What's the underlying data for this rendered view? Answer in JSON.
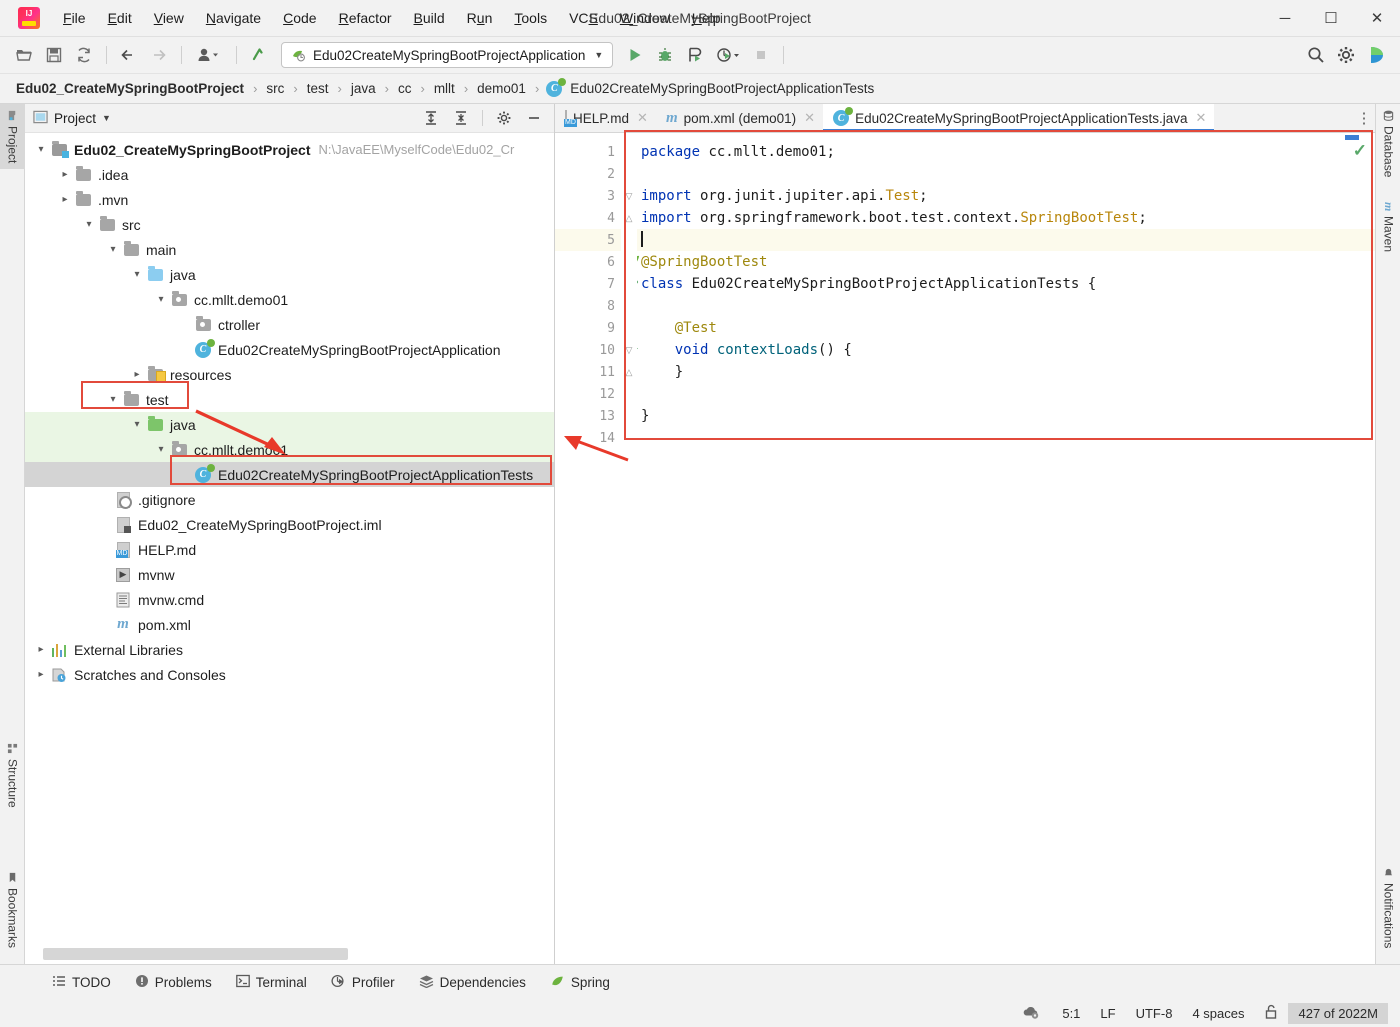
{
  "window": {
    "title": "Edu02_CreateMySpringBootProject",
    "minimize": "─",
    "maximize": "☐",
    "close": "✕"
  },
  "menubar": {
    "items": [
      "File",
      "Edit",
      "View",
      "Navigate",
      "Code",
      "Refactor",
      "Build",
      "Run",
      "Tools",
      "VCS",
      "Window",
      "Help"
    ]
  },
  "toolbar": {
    "open_icon": "open-folder-icon",
    "save_icon": "save-icon",
    "sync_icon": "sync-icon",
    "back_icon": "back-arrow-icon",
    "forward_icon": "forward-arrow-icon",
    "profile_icon": "user-profile-icon",
    "updates_icon": "updates-icon",
    "run_config": "Edu02CreateMySpringBootProjectApplication",
    "run_icon": "run-icon",
    "debug_icon": "debug-icon",
    "run_coverage_icon": "run-with-coverage-icon",
    "profiler_icon": "profiler-icon",
    "stop_icon": "stop-icon",
    "search_icon": "search-icon",
    "settings_icon": "gear-icon",
    "assistant_icon": "ai-assistant-icon"
  },
  "breadcrumb": {
    "separator": "›",
    "items": [
      "Edu02_CreateMySpringBootProject",
      "src",
      "test",
      "java",
      "cc",
      "mllt",
      "demo01",
      "Edu02CreateMySpringBootProjectApplicationTests"
    ]
  },
  "left_stripe": {
    "top": [
      {
        "label": "Project",
        "icon": "project-icon",
        "active": true
      }
    ],
    "bottom": [
      {
        "label": "Structure",
        "icon": "structure-icon"
      },
      {
        "label": "Bookmarks",
        "icon": "bookmark-icon"
      }
    ]
  },
  "right_stripe": {
    "top": [
      {
        "label": "Database",
        "icon": "database-icon"
      },
      {
        "label": "Maven",
        "icon": "maven-icon"
      }
    ],
    "bottom": [
      {
        "label": "Notifications",
        "icon": "notifications-icon"
      }
    ]
  },
  "project_panel": {
    "title": "Project",
    "dropdown_icon": "chevron-down-icon",
    "expand_icon": "expand-all-icon",
    "collapse_icon": "collapse-all-icon",
    "settings_icon": "gear-icon",
    "hide_icon": "hide-panel-icon",
    "tree": [
      {
        "label": "Edu02_CreateMySpringBootProject",
        "sub": "N:\\JavaEE\\MyselfCode\\Edu02_Cr",
        "indent": 0,
        "arrow": "expanded",
        "icon": "project-folder-icon",
        "bold": true
      },
      {
        "label": ".idea",
        "indent": 1,
        "arrow": "collapsed",
        "icon": "folder-icon"
      },
      {
        "label": ".mvn",
        "indent": 1,
        "arrow": "collapsed",
        "icon": "folder-icon"
      },
      {
        "label": "src",
        "indent": 1,
        "arrow": "expanded",
        "icon": "folder-icon"
      },
      {
        "label": "main",
        "indent": 2,
        "arrow": "expanded",
        "icon": "folder-icon"
      },
      {
        "label": "java",
        "indent": 3,
        "arrow": "expanded",
        "icon": "source-folder-icon"
      },
      {
        "label": "cc.mllt.demo01",
        "indent": 4,
        "arrow": "expanded",
        "icon": "package-icon"
      },
      {
        "label": "ctroller",
        "indent": 5,
        "arrow": "none",
        "icon": "package-icon"
      },
      {
        "label": "Edu02CreateMySpringBootProjectApplication",
        "indent": 5,
        "arrow": "none",
        "icon": "spring-class-icon"
      },
      {
        "label": "resources",
        "indent": 3,
        "arrow": "collapsed",
        "icon": "resources-folder-icon"
      },
      {
        "label": "test",
        "indent": 2,
        "arrow": "expanded",
        "icon": "folder-icon",
        "highlight": "redbox"
      },
      {
        "label": "java",
        "indent": 3,
        "arrow": "expanded",
        "icon": "test-source-folder-icon",
        "highlight": "green"
      },
      {
        "label": "cc.mllt.demo01",
        "indent": 4,
        "arrow": "expanded",
        "icon": "package-icon",
        "highlight": "green"
      },
      {
        "label": "Edu02CreateMySpringBootProjectApplicationTests",
        "indent": 5,
        "arrow": "none",
        "icon": "spring-class-icon",
        "highlight": "selected"
      },
      {
        "label": ".gitignore",
        "indent": 1,
        "arrow": "none",
        "icon": "gitignore-file-icon"
      },
      {
        "label": "Edu02_CreateMySpringBootProject.iml",
        "indent": 1,
        "arrow": "none",
        "icon": "iml-file-icon"
      },
      {
        "label": "HELP.md",
        "indent": 1,
        "arrow": "none",
        "icon": "markdown-file-icon"
      },
      {
        "label": "mvnw",
        "indent": 1,
        "arrow": "none",
        "icon": "shell-script-icon"
      },
      {
        "label": "mvnw.cmd",
        "indent": 1,
        "arrow": "none",
        "icon": "cmd-script-icon"
      },
      {
        "label": "pom.xml",
        "indent": 1,
        "arrow": "none",
        "icon": "maven-pom-icon"
      },
      {
        "label": "External Libraries",
        "indent": 0,
        "arrow": "collapsed",
        "icon": "libraries-icon"
      },
      {
        "label": "Scratches and Consoles",
        "indent": 0,
        "arrow": "collapsed",
        "icon": "scratches-icon"
      }
    ]
  },
  "editor": {
    "tabs": [
      {
        "label": "HELP.md",
        "icon": "markdown-file-icon",
        "active": false,
        "close": "✕"
      },
      {
        "label": "pom.xml (demo01)",
        "icon": "maven-pom-icon",
        "active": false,
        "close": "✕"
      },
      {
        "label": "Edu02CreateMySpringBootProjectApplicationTests.java",
        "icon": "spring-class-icon",
        "active": true,
        "close": "✕"
      }
    ],
    "tab_menu_icon": "more-options-icon",
    "inspection_status_icon": "inspection-ok-check",
    "lines": [
      {
        "n": 1,
        "gutter": "",
        "fold": "",
        "current": false
      },
      {
        "n": 2,
        "gutter": "",
        "fold": "",
        "current": false
      },
      {
        "n": 3,
        "gutter": "",
        "fold": "fold-start",
        "current": false
      },
      {
        "n": 4,
        "gutter": "",
        "fold": "fold-end",
        "current": false
      },
      {
        "n": 5,
        "gutter": "",
        "fold": "",
        "current": true
      },
      {
        "n": 6,
        "gutter": "spring-leaf-icon",
        "fold": "",
        "current": false
      },
      {
        "n": 7,
        "gutter": "run-all-tests-icon",
        "fold": "",
        "current": false
      },
      {
        "n": 8,
        "gutter": "",
        "fold": "",
        "current": false
      },
      {
        "n": 9,
        "gutter": "",
        "fold": "",
        "current": false
      },
      {
        "n": 10,
        "gutter": "run-test-icon",
        "fold": "fold-start",
        "current": false
      },
      {
        "n": 11,
        "gutter": "",
        "fold": "fold-end",
        "current": false
      },
      {
        "n": 12,
        "gutter": "",
        "fold": "",
        "current": false
      },
      {
        "n": 13,
        "gutter": "",
        "fold": "",
        "current": false
      },
      {
        "n": 14,
        "gutter": "",
        "fold": "",
        "current": false
      }
    ],
    "code_text": [
      "package cc.mllt.demo01;",
      "",
      "import org.junit.jupiter.api.Test;",
      "import org.springframework.boot.test.context.SpringBootTest;",
      "",
      "@SpringBootTest",
      "class Edu02CreateMySpringBootProjectApplicationTests {",
      "",
      "    @Test",
      "    void contextLoads() {",
      "    }",
      "",
      "}",
      ""
    ]
  },
  "bottom_bar": {
    "items": [
      {
        "label": "TODO",
        "icon": "todo-list-icon"
      },
      {
        "label": "Problems",
        "icon": "problems-icon"
      },
      {
        "label": "Terminal",
        "icon": "terminal-icon"
      },
      {
        "label": "Profiler",
        "icon": "profiler-icon"
      },
      {
        "label": "Dependencies",
        "icon": "dependencies-icon"
      },
      {
        "label": "Spring",
        "icon": "spring-leaf-icon"
      }
    ]
  },
  "status_bar": {
    "cloud_icon": "cloud-settings-icon",
    "caret_position": "5:1",
    "line_separator": "LF",
    "encoding": "UTF-8",
    "indent": "4 spaces",
    "lock_icon": "unlocked-icon",
    "memory": "427 of 2022M"
  },
  "colors": {
    "accent_blue": "#3b7fd4",
    "annotation_red": "#e24a3b",
    "green_highlight": "#eaf6e4",
    "spring_green": "#6db33f",
    "keyword_blue": "#0033b3",
    "annotation_yellow": "#9e880d"
  }
}
